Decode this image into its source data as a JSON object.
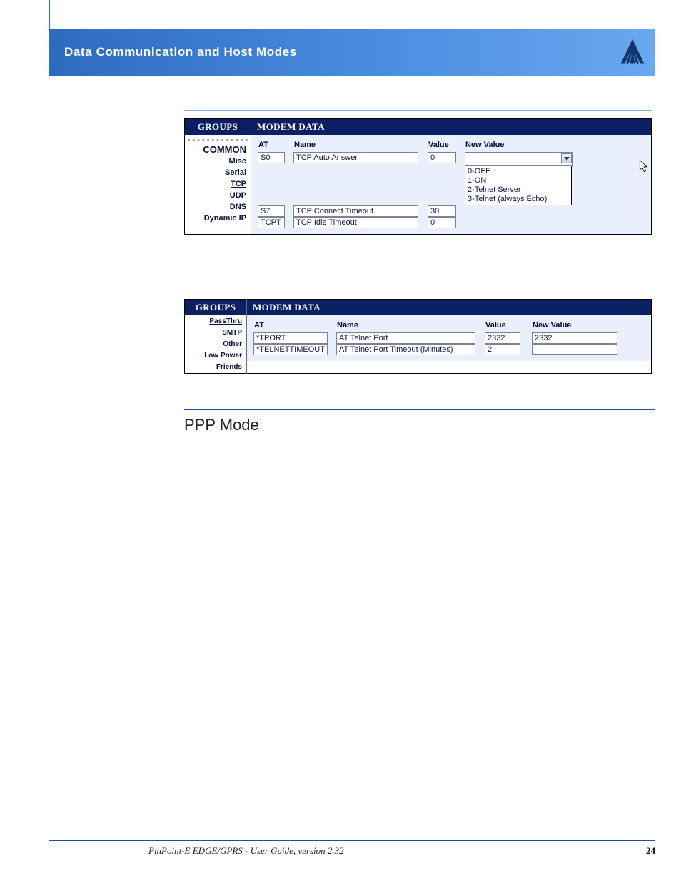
{
  "header": {
    "title": "Data Communication  and Host Modes"
  },
  "figure1": {
    "groups_header": "GROUPS",
    "data_header": "MODEM DATA",
    "nav": {
      "common": "COMMON",
      "items": [
        "Misc",
        "Serial",
        "TCP",
        "UDP",
        "DNS",
        "Dynamic IP"
      ]
    },
    "columns": {
      "at": "AT",
      "name": "Name",
      "value": "Value",
      "new_value": "New Value"
    },
    "rows": [
      {
        "at": "S0",
        "name": "TCP Auto Answer",
        "value": "0"
      },
      {
        "at": "S7",
        "name": "TCP Connect Timeout",
        "value": "30"
      },
      {
        "at": "TCPT",
        "name": "TCP Idle Timeout",
        "value": "0"
      }
    ],
    "dropdown_options": [
      "0-OFF",
      "1-ON",
      "2-Telnet Server",
      "3-Telnet (always Echo)"
    ]
  },
  "figure2": {
    "groups_header": "GROUPS",
    "data_header": "MODEM DATA",
    "nav": {
      "items": [
        "PassThru",
        "SMTP",
        "Other",
        "Low Power",
        "Friends"
      ]
    },
    "columns": {
      "at": "AT",
      "name": "Name",
      "value": "Value",
      "new_value": "New Value"
    },
    "rows": [
      {
        "at": "*TPORT",
        "name": "AT Telnet Port",
        "value": "2332",
        "new_value": "2332"
      },
      {
        "at": "*TELNETTIMEOUT",
        "name": "AT Telnet Port Timeout (Minutes)",
        "value": "2",
        "new_value": ""
      }
    ]
  },
  "section_heading": "PPP Mode",
  "footer": {
    "text": "PinPoint-E EDGE/GPRS - User Guide, version 2.32",
    "page": "24"
  }
}
